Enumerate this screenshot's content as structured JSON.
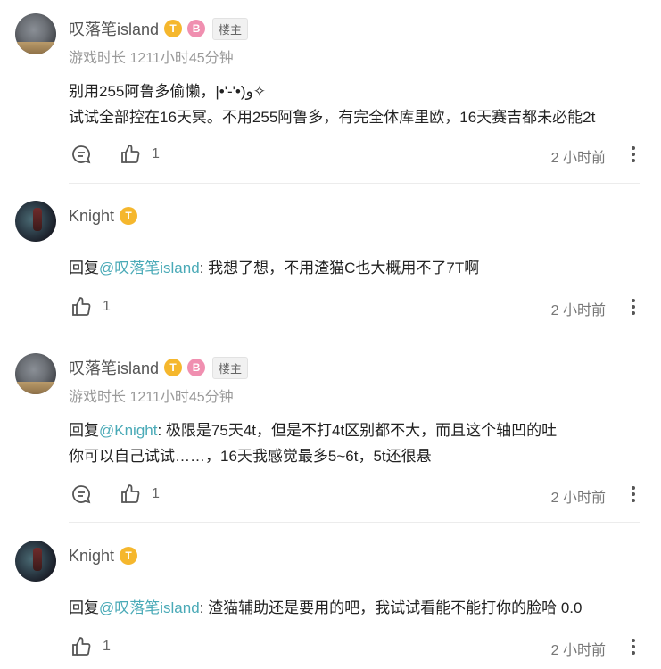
{
  "comments": [
    {
      "name": "叹落笔island",
      "badge": "T",
      "badge2": "B",
      "tag": "楼主",
      "playtime": "游戏时长 1211小时45分钟",
      "lines": [
        "别用255阿鲁多偷懒，|•'-'•)و✧",
        "试试全部控在16天冥。不用255阿鲁多，有完全体库里欧，16天赛吉都未必能2t"
      ],
      "likes": "1",
      "time": "2 小时前"
    },
    {
      "name": "Knight",
      "badge": "T",
      "reply_prefix": "回复",
      "mention": "@叹落笔island",
      "reply_text": ": 我想了想，不用渣猫C也大概用不了7T啊",
      "likes": "1",
      "time": "2 小时前"
    },
    {
      "name": "叹落笔island",
      "badge": "T",
      "badge2": "B",
      "tag": "楼主",
      "playtime": "游戏时长 1211小时45分钟",
      "reply_prefix": "回复",
      "mention": "@Knight",
      "reply_text": ": 极限是75天4t，但是不打4t区别都不大，而且这个轴凹的吐",
      "line2": "你可以自己试试……，16天我感觉最多5~6t，5t还很悬",
      "likes": "1",
      "time": "2 小时前"
    },
    {
      "name": "Knight",
      "badge": "T",
      "reply_prefix": "回复",
      "mention": "@叹落笔island",
      "reply_text": ": 渣猫辅助还是要用的吧，我试试看能不能打你的脸哈 0.0",
      "likes": "1",
      "time": "2 小时前"
    }
  ]
}
